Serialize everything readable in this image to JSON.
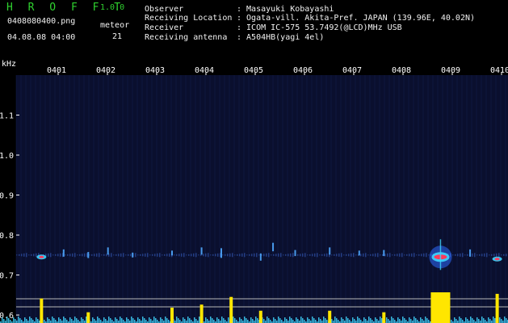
{
  "app": {
    "title": "H R O F F T",
    "version": "1.0.0"
  },
  "file": {
    "name": "0408080400.png",
    "datetime": "04.08.08 04:00"
  },
  "meteor": {
    "label": "meteor",
    "count": "21"
  },
  "info": [
    {
      "label": "Observer",
      "value": ": Masayuki Kobayashi"
    },
    {
      "label": "Receiving Location",
      "value": ": Ogata-vill. Akita-Pref. JAPAN (139.96E, 40.02N)"
    },
    {
      "label": "Receiver",
      "value": ": ICOM IC-575 53.7492(@LCD)MHz USB"
    },
    {
      "label": "Receiving antenna",
      "value": ": A504HB(yagi 4el)"
    }
  ],
  "colors": {
    "axis_text": "#ffffff",
    "title_green": "#2fd12f",
    "background": "#000000",
    "spectrogram_bg": "#0a0f2e",
    "signal_yellow": "#ffe600",
    "noise_cyan": "#3fd6ff"
  },
  "chart_data": {
    "type": "heatmap",
    "ylabel": "kHz",
    "yticks": [
      1.1,
      1.0,
      0.9,
      0.8,
      0.7,
      0.6
    ],
    "ylim": [
      0.58,
      1.2
    ],
    "xticks": [
      "0401",
      "0402",
      "0403",
      "0404",
      "0405",
      "0406",
      "0407",
      "0408",
      "0409",
      "0410"
    ],
    "echoes": [
      {
        "minute": 0.35,
        "freq": 0.745,
        "strength": 0.6
      },
      {
        "minute": 0.8,
        "freq": 0.755,
        "strength": 0.3
      },
      {
        "minute": 1.3,
        "freq": 0.75,
        "strength": 0.25
      },
      {
        "minute": 1.7,
        "freq": 0.76,
        "strength": 0.3
      },
      {
        "minute": 2.2,
        "freq": 0.75,
        "strength": 0.2
      },
      {
        "minute": 3.0,
        "freq": 0.755,
        "strength": 0.2
      },
      {
        "minute": 3.6,
        "freq": 0.76,
        "strength": 0.3
      },
      {
        "minute": 4.0,
        "freq": 0.755,
        "strength": 0.4
      },
      {
        "minute": 4.8,
        "freq": 0.745,
        "strength": 0.3
      },
      {
        "minute": 5.05,
        "freq": 0.77,
        "strength": 0.35
      },
      {
        "minute": 5.5,
        "freq": 0.755,
        "strength": 0.25
      },
      {
        "minute": 6.2,
        "freq": 0.76,
        "strength": 0.3
      },
      {
        "minute": 6.8,
        "freq": 0.755,
        "strength": 0.2
      },
      {
        "minute": 7.3,
        "freq": 0.755,
        "strength": 0.25
      },
      {
        "minute": 8.45,
        "freq": 0.745,
        "strength": 1.0
      },
      {
        "minute": 9.05,
        "freq": 0.755,
        "strength": 0.3
      },
      {
        "minute": 9.6,
        "freq": 0.74,
        "strength": 0.55
      },
      {
        "minute": 9.9,
        "freq": 0.75,
        "strength": 0.25
      }
    ],
    "bottom_signal": [
      {
        "minute": 0.35,
        "level": 0.8
      },
      {
        "minute": 1.3,
        "level": 0.35
      },
      {
        "minute": 3.0,
        "level": 0.5
      },
      {
        "minute": 3.6,
        "level": 0.6
      },
      {
        "minute": 4.2,
        "level": 0.85
      },
      {
        "minute": 4.8,
        "level": 0.4
      },
      {
        "minute": 6.2,
        "level": 0.4
      },
      {
        "minute": 7.3,
        "level": 0.35
      },
      {
        "minute": 8.45,
        "level": 1.0
      },
      {
        "minute": 9.6,
        "level": 0.95
      }
    ]
  }
}
